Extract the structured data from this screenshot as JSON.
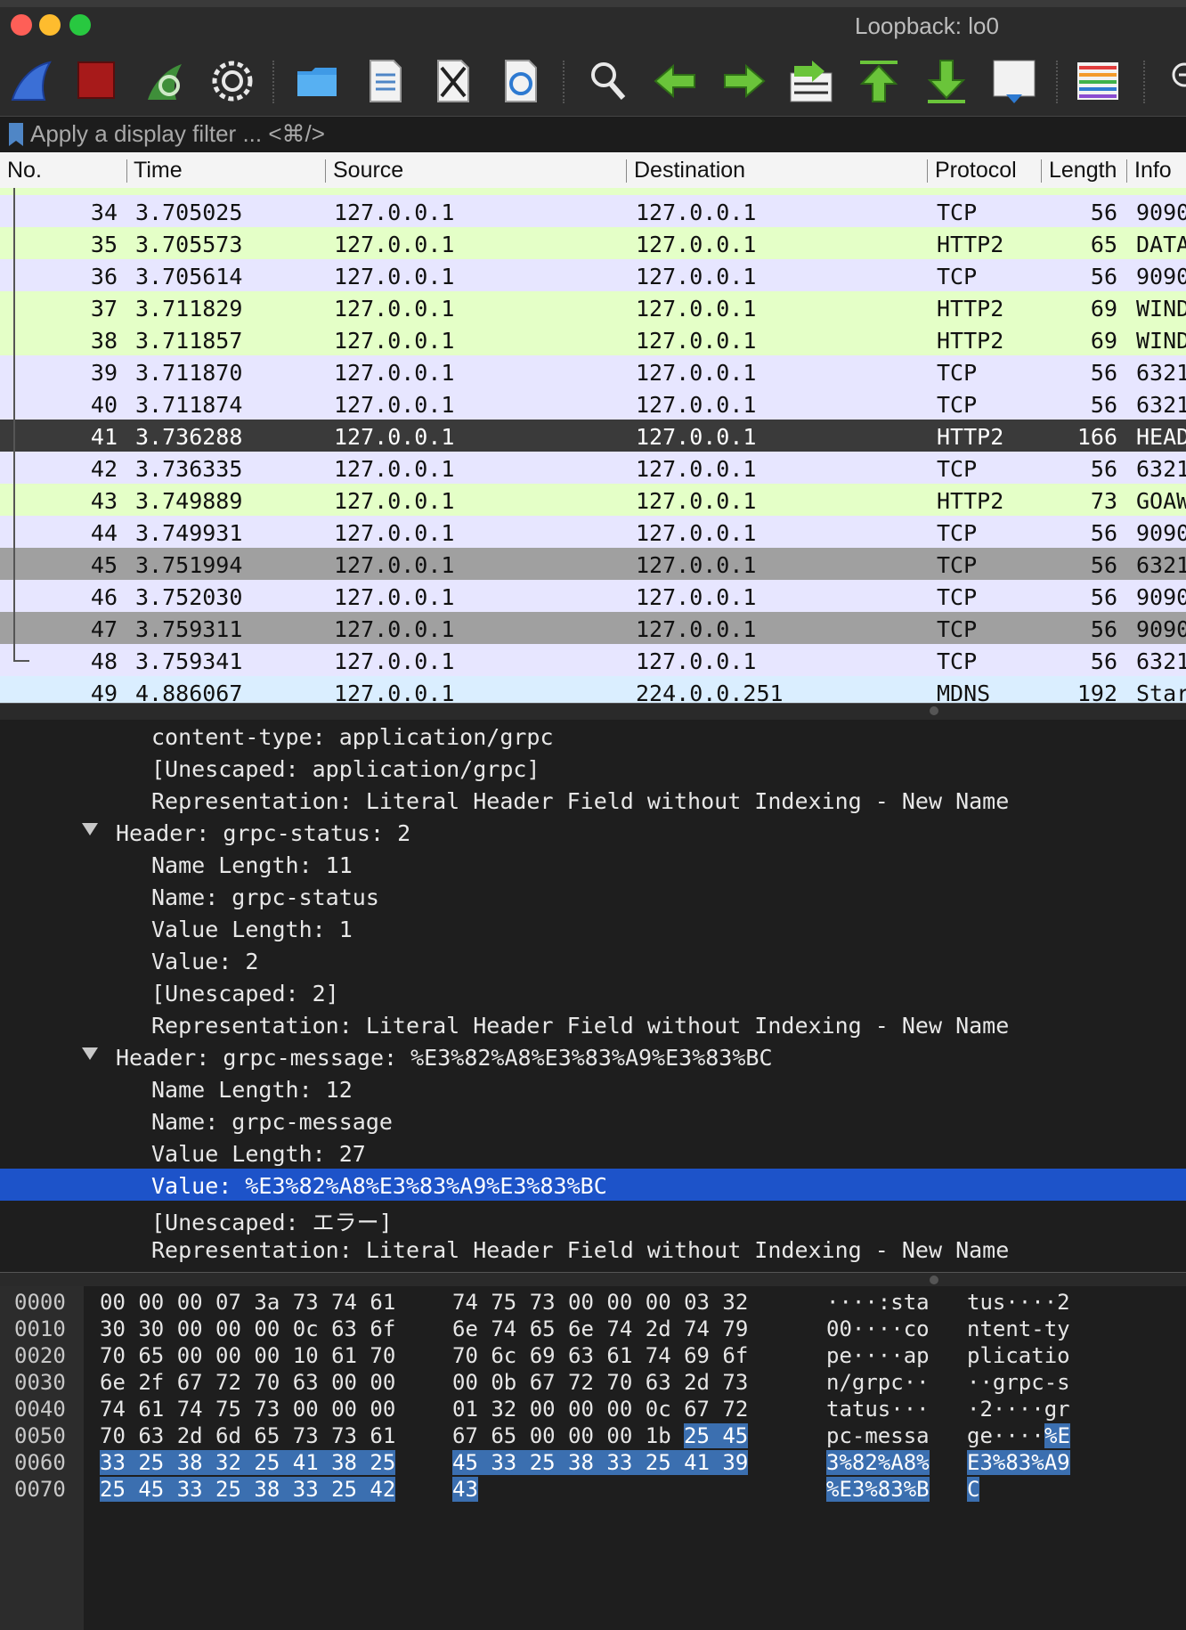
{
  "window": {
    "title": "Loopback: lo0"
  },
  "filter": {
    "placeholder": "Apply a display filter ... <⌘/>",
    "value": ""
  },
  "packet_list": {
    "columns": [
      "No.",
      "Time",
      "Source",
      "Destination",
      "Protocol",
      "Length",
      "Info"
    ],
    "rows": [
      {
        "no": "34",
        "time": "3.705025",
        "source": "127.0.0.1",
        "destination": "127.0.0.1",
        "protocol": "TCP",
        "length": "56",
        "info": "9090"
      },
      {
        "no": "35",
        "time": "3.705573",
        "source": "127.0.0.1",
        "destination": "127.0.0.1",
        "protocol": "HTTP2",
        "length": "65",
        "info": "DATA"
      },
      {
        "no": "36",
        "time": "3.705614",
        "source": "127.0.0.1",
        "destination": "127.0.0.1",
        "protocol": "TCP",
        "length": "56",
        "info": "9090"
      },
      {
        "no": "37",
        "time": "3.711829",
        "source": "127.0.0.1",
        "destination": "127.0.0.1",
        "protocol": "HTTP2",
        "length": "69",
        "info": "WIND"
      },
      {
        "no": "38",
        "time": "3.711857",
        "source": "127.0.0.1",
        "destination": "127.0.0.1",
        "protocol": "HTTP2",
        "length": "69",
        "info": "WIND"
      },
      {
        "no": "39",
        "time": "3.711870",
        "source": "127.0.0.1",
        "destination": "127.0.0.1",
        "protocol": "TCP",
        "length": "56",
        "info": "6321"
      },
      {
        "no": "40",
        "time": "3.711874",
        "source": "127.0.0.1",
        "destination": "127.0.0.1",
        "protocol": "TCP",
        "length": "56",
        "info": "6321"
      },
      {
        "no": "41",
        "time": "3.736288",
        "source": "127.0.0.1",
        "destination": "127.0.0.1",
        "protocol": "HTTP2",
        "length": "166",
        "info": "HEAD"
      },
      {
        "no": "42",
        "time": "3.736335",
        "source": "127.0.0.1",
        "destination": "127.0.0.1",
        "protocol": "TCP",
        "length": "56",
        "info": "6321"
      },
      {
        "no": "43",
        "time": "3.749889",
        "source": "127.0.0.1",
        "destination": "127.0.0.1",
        "protocol": "HTTP2",
        "length": "73",
        "info": "GOAW"
      },
      {
        "no": "44",
        "time": "3.749931",
        "source": "127.0.0.1",
        "destination": "127.0.0.1",
        "protocol": "TCP",
        "length": "56",
        "info": "9090"
      },
      {
        "no": "45",
        "time": "3.751994",
        "source": "127.0.0.1",
        "destination": "127.0.0.1",
        "protocol": "TCP",
        "length": "56",
        "info": "6321"
      },
      {
        "no": "46",
        "time": "3.752030",
        "source": "127.0.0.1",
        "destination": "127.0.0.1",
        "protocol": "TCP",
        "length": "56",
        "info": "9090"
      },
      {
        "no": "47",
        "time": "3.759311",
        "source": "127.0.0.1",
        "destination": "127.0.0.1",
        "protocol": "TCP",
        "length": "56",
        "info": "9090"
      },
      {
        "no": "48",
        "time": "3.759341",
        "source": "127.0.0.1",
        "destination": "127.0.0.1",
        "protocol": "TCP",
        "length": "56",
        "info": "6321"
      },
      {
        "no": "49",
        "time": "4.886067",
        "source": "127.0.0.1",
        "destination": "224.0.0.251",
        "protocol": "MDNS",
        "length": "192",
        "info": "Star"
      }
    ]
  },
  "details": {
    "lines": [
      "content-type: application/grpc",
      "[Unescaped: application/grpc]",
      "Representation: Literal Header Field without Indexing - New Name",
      "Header: grpc-status: 2",
      "Name Length: 11",
      "Name: grpc-status",
      "Value Length: 1",
      "Value: 2",
      "[Unescaped: 2]",
      "Representation: Literal Header Field without Indexing - New Name",
      "Header: grpc-message: %E3%82%A8%E3%83%A9%E3%83%BC",
      "Name Length: 12",
      "Name: grpc-message",
      "Value Length: 27",
      "Value: %E3%82%A8%E3%83%A9%E3%83%BC",
      "[Unescaped: エラー]",
      "Representation: Literal Header Field without Indexing - New Name"
    ]
  },
  "bytes": {
    "rows": [
      {
        "offset": "0000",
        "hex1": "00 00 00 07 3a 73 74 61",
        "hex2": "74 75 73 00 00 00 03 32",
        "ascii1": "····:sta",
        "ascii2": "tus····2"
      },
      {
        "offset": "0010",
        "hex1": "30 30 00 00 00 0c 63 6f",
        "hex2": "6e 74 65 6e 74 2d 74 79",
        "ascii1": "00····co",
        "ascii2": "ntent-ty"
      },
      {
        "offset": "0020",
        "hex1": "70 65 00 00 00 10 61 70",
        "hex2": "70 6c 69 63 61 74 69 6f",
        "ascii1": "pe····ap",
        "ascii2": "plicatio"
      },
      {
        "offset": "0030",
        "hex1": "6e 2f 67 72 70 63 00 00",
        "hex2": "00 0b 67 72 70 63 2d 73",
        "ascii1": "n/grpc··",
        "ascii2": "··grpc-s"
      },
      {
        "offset": "0040",
        "hex1": "74 61 74 75 73 00 00 00",
        "hex2": "01 32 00 00 00 0c 67 72",
        "ascii1": "tatus···",
        "ascii2": "·2····gr"
      },
      {
        "offset": "0050",
        "hex1": "70 63 2d 6d 65 73 73 61",
        "hex2": "67 65 00 00 00 1b ",
        "hex2_hl": "25 45",
        "ascii1": "pc-messa",
        "ascii2": "ge····",
        "ascii2_hl": "%E"
      },
      {
        "offset": "0060",
        "hex1": "",
        "hex1_hl": "33 25 38 32 25 41 38 25",
        "hex2": "",
        "hex2_hl": "45 33 25 38 33 25 41 39",
        "ascii1": "",
        "ascii1_hl": "3%82%A8%",
        "ascii2": "",
        "ascii2_hl": "E3%83%A9"
      },
      {
        "offset": "0070",
        "hex1": "",
        "hex1_hl": "25 45 33 25 38 33 25 42",
        "hex2": "",
        "hex2_hl": "43",
        "ascii1": "",
        "ascii1_hl": "%E3%83%B",
        "ascii2": "",
        "ascii2_hl": "C"
      }
    ]
  },
  "colors": {
    "row_tcp": "#e7e6ff",
    "row_http2": "#e4ffc7",
    "row_mdns": "#daeeff",
    "row_selected": "#3a3a3a",
    "row_gray": "#a0a0a0",
    "detail_selected": "#1d53c9",
    "bytes_highlight": "#3b6fb0"
  }
}
